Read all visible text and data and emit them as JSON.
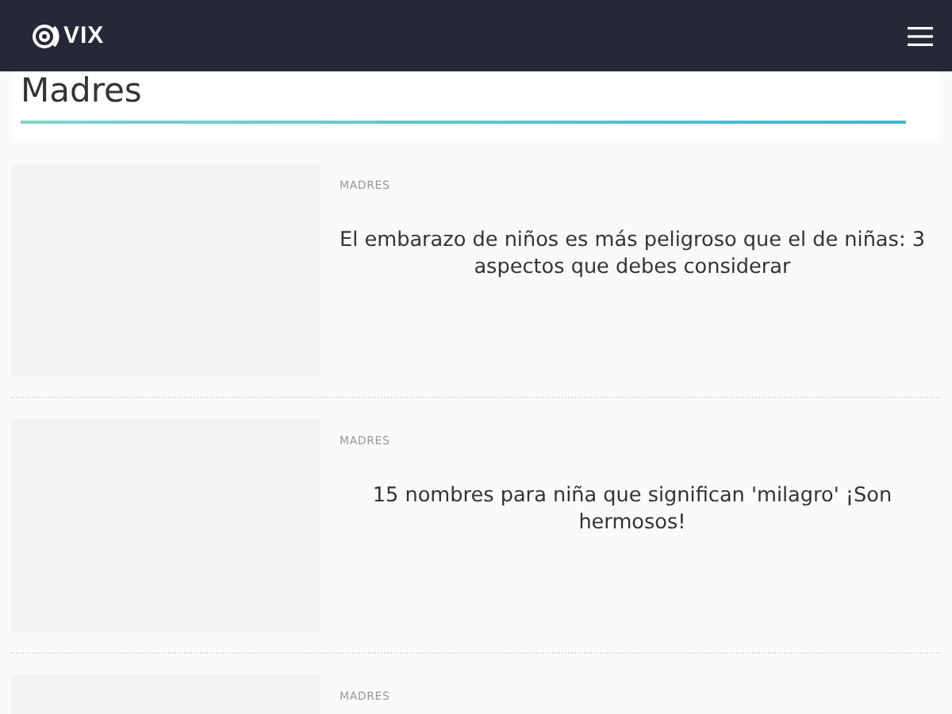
{
  "header": {
    "logo": "VIX"
  },
  "section": {
    "title": "Madres"
  },
  "articles": [
    {
      "category": "MADRES",
      "title": "El embarazo de niños es más peligroso que el de niñas: 3 aspectos que debes considerar"
    },
    {
      "category": "MADRES",
      "title": "15 nombres para niña que significan 'milagro' ¡Son hermosos!"
    },
    {
      "category": "MADRES"
    }
  ]
}
